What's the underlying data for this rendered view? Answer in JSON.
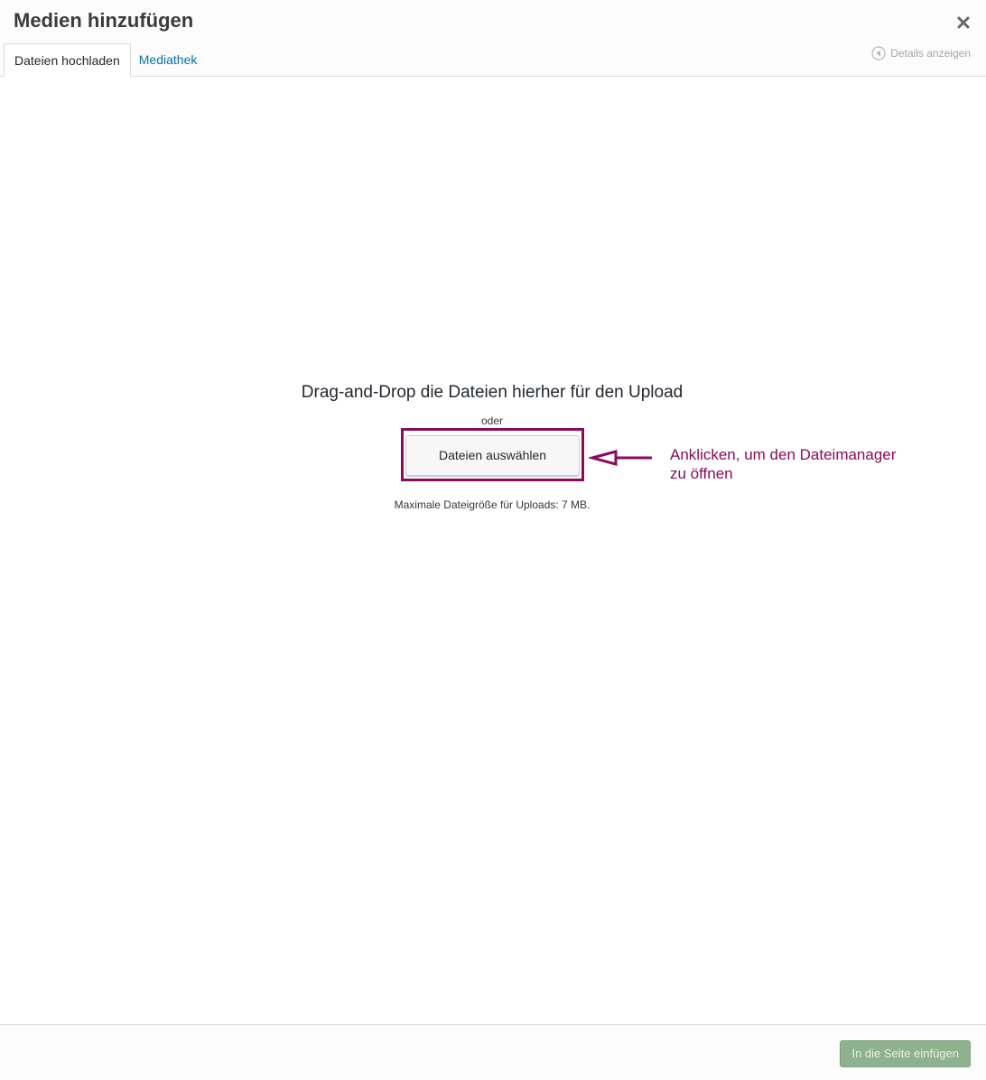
{
  "header": {
    "title": "Medien hinzufügen",
    "close_icon": "close-icon",
    "tabs": [
      {
        "label": "Dateien hochladen",
        "active": true
      },
      {
        "label": "Mediathek",
        "active": false
      }
    ],
    "details_toggle": {
      "label": "Details anzeigen",
      "icon": "circle-arrow-left-icon"
    }
  },
  "upload": {
    "drop_title": "Drag-and-Drop die Dateien hierher für den Upload",
    "or_text": "oder",
    "select_button": "Dateien auswählen",
    "max_size": "Maximale Dateigröße für Uploads: 7 MB."
  },
  "annotation": {
    "lines": [
      "Anklicken, um den Dateimanager",
      "zu öffnen"
    ],
    "color": "#8b0b5a"
  },
  "footer": {
    "insert_button": "In die Seite einfügen"
  },
  "colors": {
    "link": "#0073aa",
    "annotation": "#8b0b5a",
    "insert_button_disabled": "#8fb28e"
  }
}
